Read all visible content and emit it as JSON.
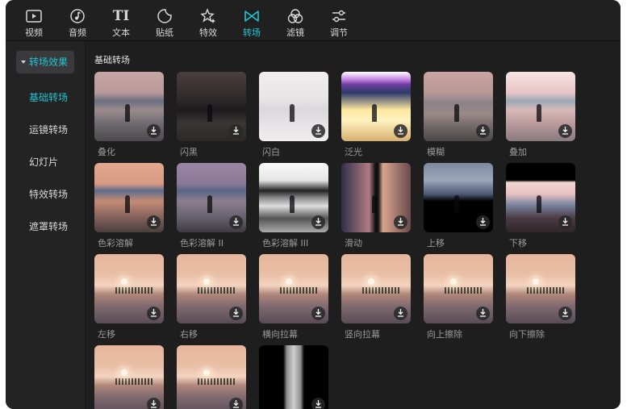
{
  "toolbar": {
    "items": [
      {
        "label": "视频",
        "icon": "video-icon"
      },
      {
        "label": "音频",
        "icon": "audio-icon"
      },
      {
        "label": "文本",
        "icon": "text-icon"
      },
      {
        "label": "贴纸",
        "icon": "sticker-icon"
      },
      {
        "label": "特效",
        "icon": "effects-icon"
      },
      {
        "label": "转场",
        "icon": "transition-icon",
        "active": true
      },
      {
        "label": "滤镜",
        "icon": "filter-icon"
      },
      {
        "label": "调节",
        "icon": "adjust-icon"
      }
    ],
    "text_icon_glyph": "TI"
  },
  "sidebar": {
    "header": "转场效果",
    "items": [
      {
        "label": "基础转场",
        "active": true
      },
      {
        "label": "运镜转场"
      },
      {
        "label": "幻灯片"
      },
      {
        "label": "特效转场"
      },
      {
        "label": "遮罩转场"
      }
    ]
  },
  "content": {
    "section_title": "基础转场",
    "transitions": [
      {
        "label": "叠化",
        "style": "dissolve"
      },
      {
        "label": "闪黑",
        "style": "dark"
      },
      {
        "label": "闪白",
        "style": "white"
      },
      {
        "label": "泛光",
        "style": "glow"
      },
      {
        "label": "模糊",
        "style": "blur"
      },
      {
        "label": "叠加",
        "style": "overlay"
      },
      {
        "label": "色彩溶解",
        "style": "sunset"
      },
      {
        "label": "色彩溶解 II",
        "style": "sunset2"
      },
      {
        "label": "色彩溶解 III",
        "style": "bw"
      },
      {
        "label": "滑动",
        "style": "slide"
      },
      {
        "label": "上移",
        "style": "up"
      },
      {
        "label": "下移",
        "style": "down"
      },
      {
        "label": "左移",
        "style": "sun"
      },
      {
        "label": "右移",
        "style": "sun"
      },
      {
        "label": "横向拉幕",
        "style": "sun"
      },
      {
        "label": "竖向拉幕",
        "style": "sun"
      },
      {
        "label": "向上擦除",
        "style": "sun"
      },
      {
        "label": "向下擦除",
        "style": "sun"
      },
      {
        "label": "",
        "style": "sun"
      },
      {
        "label": "",
        "style": "sun"
      },
      {
        "label": "",
        "style": "blackcurtain"
      }
    ]
  },
  "colors": {
    "accent": "#22c4d4",
    "background": "#1e1e1f",
    "sidebar": "#232324"
  }
}
